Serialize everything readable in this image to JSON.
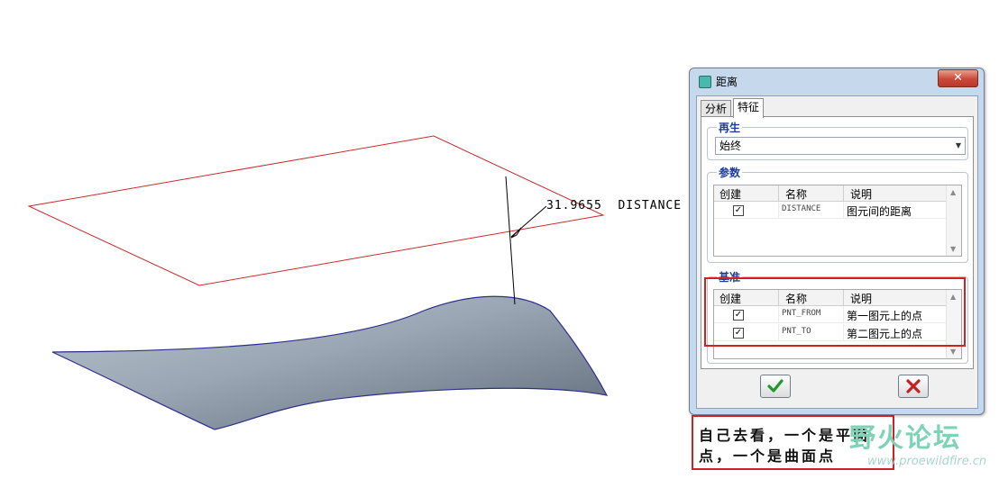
{
  "viewport": {
    "dimension_value": "31.9655",
    "dimension_label": "DISTANCE"
  },
  "dialog": {
    "title": "距离",
    "close_label": "✕",
    "tabs": [
      {
        "label": "分析",
        "active": false
      },
      {
        "label": "特征",
        "active": true
      }
    ],
    "regen": {
      "label": "再生",
      "selected": "始终"
    },
    "params": {
      "label": "参数",
      "columns": [
        "创建",
        "名称",
        "说明"
      ],
      "rows": [
        {
          "checked": true,
          "name": "DISTANCE",
          "desc": "图元间的距离"
        }
      ]
    },
    "datums": {
      "label": "基准",
      "columns": [
        "创建",
        "名称",
        "说明"
      ],
      "rows": [
        {
          "checked": true,
          "name": "PNT_FROM",
          "desc": "第一图元上的点"
        },
        {
          "checked": true,
          "name": "PNT_TO",
          "desc": "第二图元上的点"
        }
      ]
    },
    "ok_icon": "check-icon",
    "cancel_icon": "x-icon"
  },
  "annotation": {
    "line1": "自己去看，一个是平面",
    "line2": "点，一个是曲面点"
  },
  "watermark": {
    "text": "野火论坛",
    "url": "www.proewildfire.cn"
  },
  "colors": {
    "plane_edge": "#cc2a2a",
    "surface_fill": "#9aa6b3",
    "highlight": "#d12020"
  }
}
